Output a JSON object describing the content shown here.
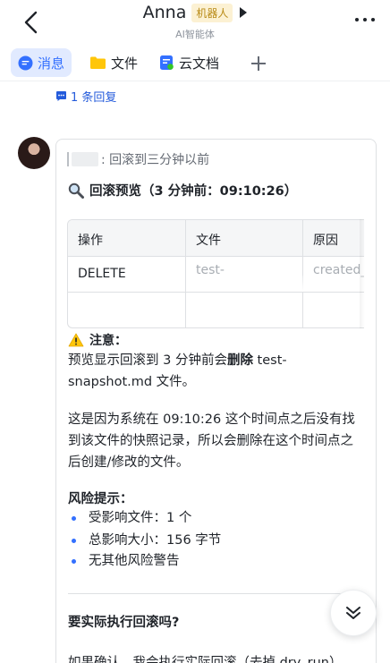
{
  "header": {
    "title": "Anna",
    "badge": "机器人",
    "subtitle": "AI智能体"
  },
  "tabs": [
    {
      "label": "消息",
      "icon": "chat-bubble-icon"
    },
    {
      "label": "文件",
      "icon": "folder-icon"
    },
    {
      "label": "云文档",
      "icon": "cloud-doc-icon"
    }
  ],
  "reply": {
    "label": "1 条回复"
  },
  "message": {
    "quote_text": ": 回滚到三分钟以前",
    "preview_title": "回滚预览（3 分钟前：09:10:26）",
    "table": {
      "headers": [
        "操作",
        "文件",
        "原因"
      ],
      "rows": [
        [
          "DELETE",
          "test-",
          "created_"
        ],
        [
          "",
          "",
          ""
        ]
      ]
    },
    "note_title": "注意：",
    "note_p1_pre": "预览显示回滚到 3 分钟前会",
    "note_p1_bold": "删除",
    "note_p1_post": " test-snapshot.md 文件。",
    "note_p2": "这是因为系统在 09:10:26 这个时间点之后没有找到该文件的快照记录，所以会删除在这个时间点之后创建/修改的文件。",
    "risk_title": "风险提示：",
    "risks": [
      "受影响文件：1 个",
      "总影响大小：156 字节",
      "无其他风险警告"
    ],
    "confirm_question": "要实际执行回滚吗?",
    "cut_text": "如果确认，我会执行实际回滚（去掉 dry_run）"
  },
  "colors": {
    "accent": "#3370ff",
    "badge_bg": "#fcf1d3",
    "badge_text": "#b88a16"
  }
}
